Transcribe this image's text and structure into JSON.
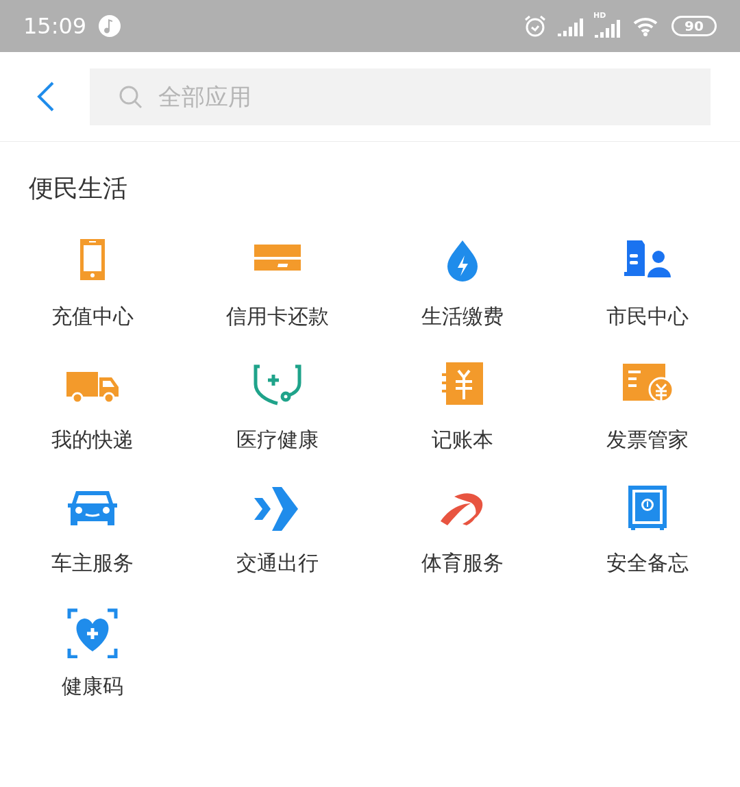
{
  "status_bar": {
    "time": "15:09",
    "network_label": "HD",
    "battery": "90"
  },
  "search": {
    "placeholder": "全部应用"
  },
  "section": {
    "title": "便民生活",
    "apps": [
      {
        "label": "充值中心",
        "kind": "phone"
      },
      {
        "label": "信用卡还款",
        "kind": "card"
      },
      {
        "label": "生活缴费",
        "kind": "drop"
      },
      {
        "label": "市民中心",
        "kind": "citizen"
      },
      {
        "label": "我的快递",
        "kind": "truck"
      },
      {
        "label": "医疗健康",
        "kind": "stethoscope"
      },
      {
        "label": "记账本",
        "kind": "ledger"
      },
      {
        "label": "发票管家",
        "kind": "invoice"
      },
      {
        "label": "车主服务",
        "kind": "car"
      },
      {
        "label": "交通出行",
        "kind": "arrows"
      },
      {
        "label": "体育服务",
        "kind": "sport"
      },
      {
        "label": "安全备忘",
        "kind": "safe"
      },
      {
        "label": "健康码",
        "kind": "healthcode"
      }
    ]
  }
}
